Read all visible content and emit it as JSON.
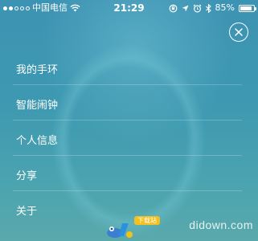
{
  "status_bar": {
    "carrier": "中国电信",
    "time": "21:29",
    "battery_percent": "85%",
    "battery_level": 0.85,
    "signal_filled": 2,
    "signal_total": 5
  },
  "close_icon": "close-icon",
  "menu": {
    "items": [
      {
        "label": "我的手环"
      },
      {
        "label": "智能闹钟"
      },
      {
        "label": "个人信息"
      },
      {
        "label": "分享"
      },
      {
        "label": "关于"
      }
    ]
  },
  "watermark": {
    "badge": "下载站",
    "site": "didown.com"
  },
  "colors": {
    "background": "#3f97b4",
    "text": "#ffffff",
    "badge": "#f3c01e"
  }
}
